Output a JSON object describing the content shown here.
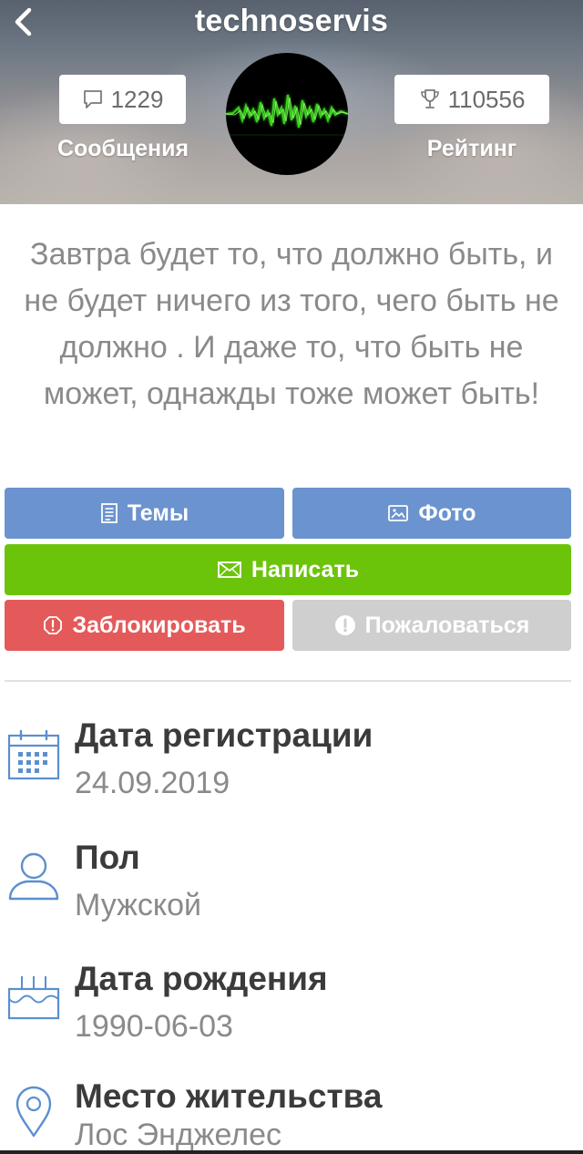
{
  "header": {
    "username": "technoservis",
    "messages_count": "1229",
    "messages_label": "Сообщения",
    "rating_value": "110556",
    "rating_label": "Рейтинг"
  },
  "status_text": "Завтра будет то, что должно быть, и не будет ничего из того, чего быть не должно .  И даже то, что быть не может, однажды тоже может быть!",
  "buttons": {
    "topics": "Темы",
    "photo": "Фото",
    "write": "Написать",
    "block": "Заблокировать",
    "report": "Пожаловаться"
  },
  "info": {
    "registration": {
      "label": "Дата регистрации",
      "value": "24.09.2019"
    },
    "gender": {
      "label": "Пол",
      "value": "Мужской"
    },
    "birthday": {
      "label": "Дата рождения",
      "value": "1990-06-03"
    },
    "location": {
      "label": "Место жительства",
      "value": "Лос Энджелес"
    }
  },
  "colors": {
    "button_blue": "#6b93cf",
    "button_green": "#6cc40a",
    "button_red": "#e45a5a",
    "button_gray": "#cfcfcf",
    "icon_blue": "#5b8fcf"
  }
}
